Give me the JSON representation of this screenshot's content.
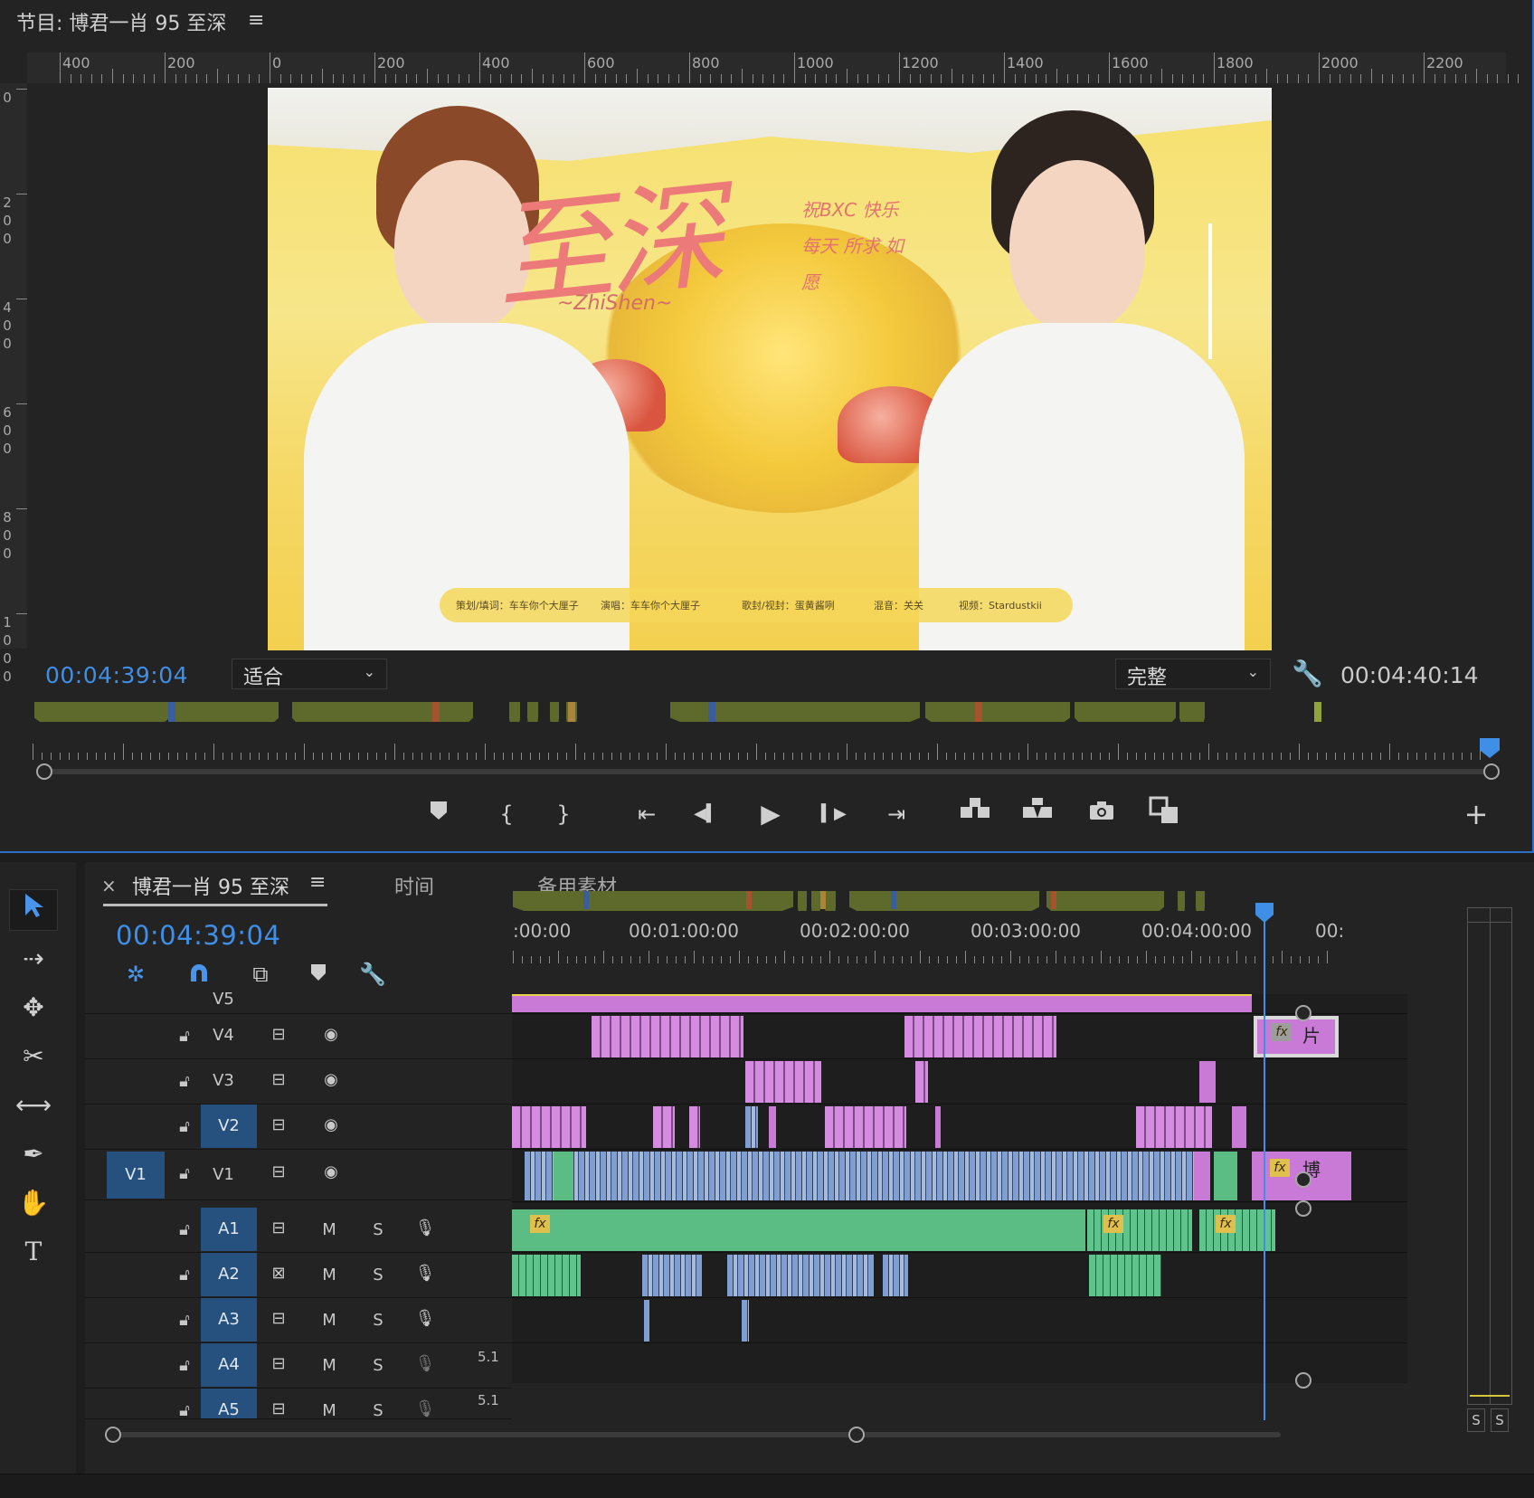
{
  "program_monitor": {
    "title": "节目: 博君一肖 95 至深",
    "menu_glyph": "≡",
    "ruler_h_labels": [
      "400",
      "200",
      "0",
      "200",
      "400",
      "600",
      "800",
      "1000",
      "1200",
      "1400",
      "1600",
      "1800",
      "2000",
      "2200"
    ],
    "ruler_v_labels": [
      "0",
      "200",
      "400",
      "600",
      "800",
      "1000"
    ],
    "current_timecode": "00:04:39:04",
    "zoom_select": "适合",
    "quality_select": "完整",
    "duration_timecode": "00:04:40:14",
    "video": {
      "title_art": "至深",
      "subtitle_art": "~ZhiShen~",
      "side_text": "祝BXC 快乐每天 所求 如愿",
      "credits": [
        "策划/填词：车车你个大厘子",
        "演唱：车车你个大厘子",
        "歌封/视封：蛋黄酱咧",
        "混音：关关",
        "视频：Stardustkii"
      ]
    },
    "transport": {
      "add_marker": "add-marker",
      "mark_in": "{",
      "mark_out": "}",
      "go_to_in": "⇤",
      "step_back": "◀▍",
      "play": "▶",
      "step_forward": "▍▶",
      "go_to_out": "⇥",
      "lift": "lift",
      "extract": "extract",
      "export_frame": "camera",
      "compare": "compare",
      "add": "+"
    }
  },
  "timeline": {
    "close_glyph": "×",
    "tabs": [
      {
        "label": "博君一肖 95 至深",
        "active": true
      },
      {
        "label": "时间",
        "active": false
      },
      {
        "label": "备用素材",
        "active": false
      }
    ],
    "tab_menu_glyph": "≡",
    "current_timecode": "00:04:39:04",
    "ruler_labels": [
      ":00:00",
      "00:01:00:00",
      "00:02:00:00",
      "00:03:00:00",
      "00:04:00:00",
      "00:"
    ],
    "video_tracks": [
      {
        "name": "V5",
        "source_patch": "",
        "targeted": false
      },
      {
        "name": "V4",
        "source_patch": "",
        "targeted": false
      },
      {
        "name": "V3",
        "source_patch": "",
        "targeted": false
      },
      {
        "name": "V2",
        "source_patch": "",
        "targeted": true
      },
      {
        "name": "V1",
        "source_patch": "V1",
        "targeted": false
      }
    ],
    "audio_tracks": [
      {
        "name": "A1",
        "mute": "M",
        "solo": "S",
        "channels": ""
      },
      {
        "name": "A2",
        "mute": "M",
        "solo": "S",
        "channels": ""
      },
      {
        "name": "A3",
        "mute": "M",
        "solo": "S",
        "channels": ""
      },
      {
        "name": "A4",
        "mute": "M",
        "solo": "S",
        "channels": "5.1"
      },
      {
        "name": "A5",
        "mute": "M",
        "solo": "S",
        "channels": "5.1"
      }
    ],
    "clip_labels": {
      "v4_end": "片",
      "v1_end": "博",
      "fx": "fx"
    }
  },
  "audio_meter": {
    "solo_left": "S",
    "solo_right": "S"
  },
  "colors": {
    "accent_blue": "#3f8fe6",
    "video_clip_pink": "#c97ad6",
    "video_clip_blue": "#7f9fd2",
    "audio_clip_green": "#5bbd84",
    "track_target_blue": "#26507e"
  }
}
